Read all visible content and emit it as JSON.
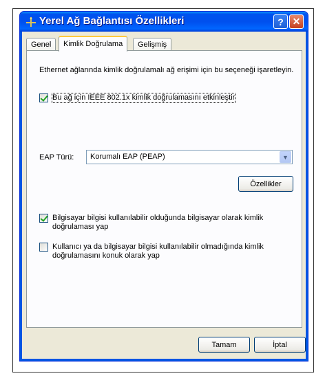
{
  "window": {
    "title": "Yerel Ağ Bağlantısı Özellikleri",
    "help_label": "?",
    "close_label": "✕"
  },
  "tabs": [
    {
      "label": "Genel"
    },
    {
      "label": "Kimlik Doğrulama",
      "active": true
    },
    {
      "label": "Gelişmiş"
    }
  ],
  "auth": {
    "description": "Ethernet ağlarında kimlik doğrulamalı ağ erişimi için bu seçeneği işaretleyin.",
    "enable_8021x": {
      "label": "Bu ağ için IEEE 802.1x kimlik doğrulamasını etkinleştir",
      "checked": true
    },
    "eap_type_label": "EAP Türü:",
    "eap_type_value": "Korumalı EAP (PEAP)",
    "properties_button": "Özellikler",
    "computer_auth": {
      "label": "Bilgisayar bilgisi kullanılabilir olduğunda bilgisayar olarak kimlik doğrulaması yap",
      "checked": true
    },
    "guest_auth": {
      "label": "Kullanıcı ya da bilgisayar bilgisi kullanılabilir olmadığında kimlik doğrulamasını konuk olarak yap",
      "checked": false
    }
  },
  "footer": {
    "ok_button": "Tamam",
    "cancel_button": "İptal"
  },
  "colors": {
    "titlebar": "#0054e3",
    "dialog_bg": "#ece9d8",
    "tab_highlight": "#ffc83c",
    "check_green": "#21a121"
  }
}
